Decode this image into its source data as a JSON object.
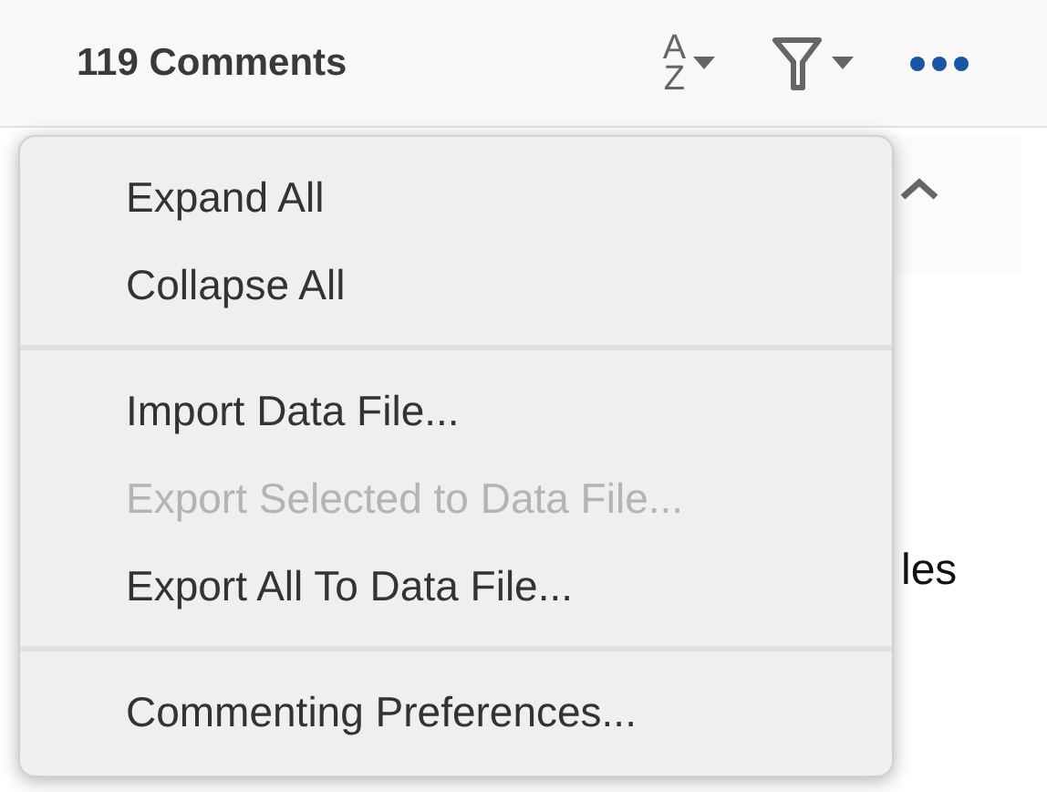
{
  "header": {
    "title": "119 Comments",
    "sort_letters": [
      "A",
      "Z"
    ]
  },
  "comment": {
    "text_fragments": [
      "les"
    ]
  },
  "menu": {
    "sections": [
      [
        {
          "label": "Expand All",
          "disabled": false
        },
        {
          "label": "Collapse All",
          "disabled": false
        }
      ],
      [
        {
          "label": "Import Data File...",
          "disabled": false
        },
        {
          "label": "Export Selected to Data File...",
          "disabled": true
        },
        {
          "label": "Export All To Data File...",
          "disabled": false
        }
      ],
      [
        {
          "label": "Commenting Preferences...",
          "disabled": false
        }
      ]
    ]
  }
}
